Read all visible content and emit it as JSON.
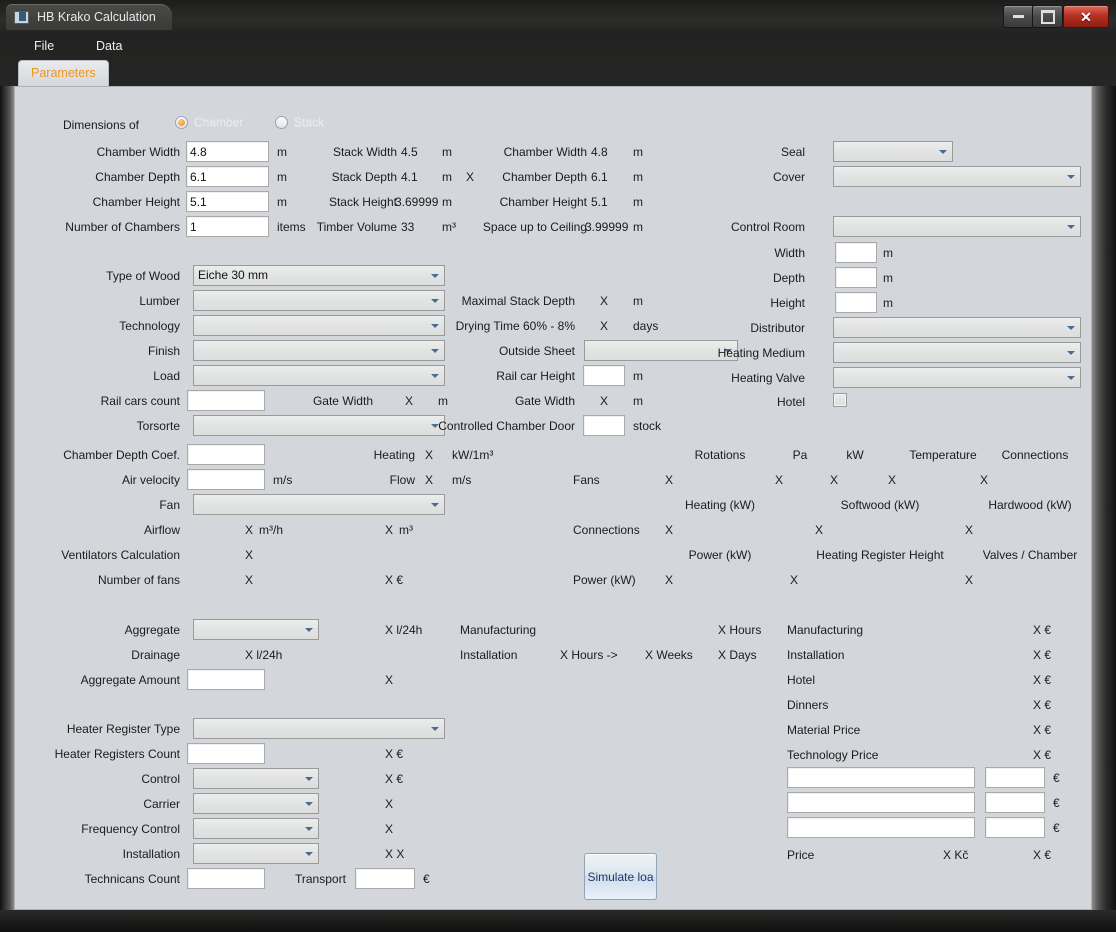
{
  "window": {
    "title": "HB Krako Calculation",
    "controls": {
      "minimize": "–",
      "maximize": "□",
      "close": "✕"
    }
  },
  "menu": {
    "items": [
      "File",
      "Data"
    ]
  },
  "tabs": [
    {
      "label": "Parameters",
      "active": true
    }
  ],
  "dimensions": {
    "group_label": "Dimensions of",
    "radios": [
      {
        "label": "Chamber",
        "selected": true
      },
      {
        "label": "Stack",
        "selected": false
      }
    ],
    "left_rows": [
      {
        "label": "Chamber Width",
        "value": "4.8",
        "unit": "m"
      },
      {
        "label": "Chamber Depth",
        "value": "6.1",
        "unit": "m"
      },
      {
        "label": "Chamber Height",
        "value": "5.1",
        "unit": "m"
      },
      {
        "label": "Number of Chambers",
        "value": "1",
        "unit": "items"
      }
    ],
    "stack_rows": [
      {
        "label": "Stack Width",
        "value": "4.5",
        "unit": "m"
      },
      {
        "label": "Stack Depth",
        "value": "4.1",
        "unit": "m",
        "sep": "X"
      },
      {
        "label": "Stack Height",
        "value": "3.69999",
        "unit": "m"
      },
      {
        "label": "Timber Volume",
        "value": "33",
        "unit": "m³"
      }
    ],
    "chamber_rows": [
      {
        "label": "Chamber Width",
        "value": "4.8",
        "unit": "m"
      },
      {
        "label": "Chamber Depth",
        "value": "6.1",
        "unit": "m"
      },
      {
        "label": "Chamber Height",
        "value": "5.1",
        "unit": "m"
      },
      {
        "label": "Space up to Ceiling",
        "value": "3.99999",
        "unit": "m"
      }
    ]
  },
  "left_column": {
    "type_of_wood": {
      "label": "Type of Wood",
      "value": "Eiche 30 mm"
    },
    "lumber": {
      "label": "Lumber",
      "value": ""
    },
    "technology": {
      "label": "Technology",
      "value": ""
    },
    "finish": {
      "label": "Finish",
      "value": ""
    },
    "load": {
      "label": "Load",
      "value": ""
    },
    "rail_cars_count": {
      "label": "Rail cars count",
      "value": ""
    },
    "gate_width": {
      "label": "Gate Width",
      "value": "X",
      "unit": "m"
    },
    "torsorte": {
      "label": "Torsorte",
      "value": ""
    },
    "chamber_depth_coef": {
      "label": "Chamber Depth Coef.",
      "value": ""
    },
    "air_velocity": {
      "label": "Air velocity",
      "value": "",
      "unit": "m/s"
    },
    "fan": {
      "label": "Fan",
      "value": ""
    },
    "airflow": {
      "label": "Airflow",
      "value": "X",
      "unit": "m³/h",
      "value2": "X",
      "unit2": "m³"
    },
    "ventilators_calc": {
      "label": "Ventilators Calculation",
      "value": "X"
    },
    "number_of_fans": {
      "label": "Number of fans",
      "value": "X",
      "value2": "X €"
    }
  },
  "mid_column": {
    "maximal_stack_depth": {
      "label": "Maximal Stack Depth",
      "value": "X",
      "unit": "m"
    },
    "drying_time": {
      "label": "Drying Time 60% - 8%",
      "value": "X",
      "unit": "days"
    },
    "outside_sheet": {
      "label": "Outside Sheet",
      "value": ""
    },
    "rail_car_height": {
      "label": "Rail car Height",
      "value": "",
      "unit": "m"
    },
    "gate_width": {
      "label": "Gate Width",
      "value": "X",
      "unit": "m"
    },
    "controlled_chamber_door": {
      "label": "Controlled Chamber Door",
      "value": "",
      "unit": "stock"
    },
    "heating": {
      "label": "Heating",
      "value": "X",
      "unit": "kW/1m³"
    },
    "flow": {
      "label": "Flow",
      "value": "X",
      "unit": "m/s"
    }
  },
  "fans_table": {
    "header1": [
      "Rotations",
      "Pa",
      "kW",
      "Temperature",
      "Connections"
    ],
    "row1": {
      "label": "Fans",
      "values": [
        "X",
        "X",
        "X",
        "X",
        "X"
      ]
    },
    "header2": [
      "Heating (kW)",
      "Softwood (kW)",
      "Hardwood (kW)"
    ],
    "row2": {
      "label": "Connections",
      "values": [
        "X",
        "X",
        "X"
      ]
    },
    "header3": [
      "Power (kW)",
      "Heating Register Height",
      "Valves / Chamber"
    ],
    "row3": {
      "label": "Power (kW)",
      "values": [
        "X",
        "X",
        "X"
      ]
    }
  },
  "right_column": {
    "seal": {
      "label": "Seal",
      "value": ""
    },
    "cover": {
      "label": "Cover",
      "value": ""
    },
    "control_room": {
      "label": "Control Room",
      "value": ""
    },
    "width": {
      "label": "Width",
      "value": "",
      "unit": "m"
    },
    "depth": {
      "label": "Depth",
      "value": "",
      "unit": "m"
    },
    "height": {
      "label": "Height",
      "value": "",
      "unit": "m"
    },
    "distributor": {
      "label": "Distributor",
      "value": ""
    },
    "heating_medium": {
      "label": "Heating Medium",
      "value": ""
    },
    "heating_valve": {
      "label": "Heating Valve",
      "value": ""
    },
    "hotel": {
      "label": "Hotel",
      "checked": false
    }
  },
  "aggregate_section": {
    "aggregate": {
      "label": "Aggregate",
      "value": "",
      "result": "X l/24h"
    },
    "drainage": {
      "label": "Drainage",
      "value": "X l/24h"
    },
    "aggregate_amount": {
      "label": "Aggregate Amount",
      "value": "",
      "result": "X"
    }
  },
  "time_section": {
    "manufacturing": {
      "label": "Manufacturing",
      "hours": "X Hours"
    },
    "installation": {
      "label": "Installation",
      "hours": "X Hours ->",
      "weeks": "X Weeks",
      "days": "X Days"
    }
  },
  "price_section": {
    "rows": [
      {
        "label": "Manufacturing",
        "value": "X €"
      },
      {
        "label": "Installation",
        "value": "X €"
      },
      {
        "label": "Hotel",
        "value": "X €"
      },
      {
        "label": "Dinners",
        "value": "X €"
      },
      {
        "label": "Material Price",
        "value": "X €"
      },
      {
        "label": "Technology Price",
        "value": "X €"
      }
    ],
    "extra_inputs": [
      {
        "note": "",
        "amount": "",
        "unit": "€"
      },
      {
        "note": "",
        "amount": "",
        "unit": "€"
      },
      {
        "note": "",
        "amount": "",
        "unit": "€"
      }
    ],
    "total": {
      "label": "Price",
      "czk": "X Kč",
      "eur": "X €"
    }
  },
  "heater_section": {
    "heater_register_type": {
      "label": "Heater Register Type",
      "value": ""
    },
    "heater_registers_count": {
      "label": "Heater Registers Count",
      "value": "",
      "price": "X €"
    },
    "control": {
      "label": "Control",
      "value": "",
      "price": "X €"
    },
    "carrier": {
      "label": "Carrier",
      "value": "",
      "price": "X"
    },
    "frequency_control": {
      "label": "Frequency Control",
      "value": "",
      "price": "X"
    },
    "installation": {
      "label": "Installation",
      "value": "",
      "price": "X X"
    },
    "technicans_count": {
      "label": "Technicans Count",
      "value": ""
    },
    "transport": {
      "label": "Transport",
      "value": "",
      "unit": "€"
    }
  },
  "actions": {
    "simulate": "Simulate loa"
  }
}
